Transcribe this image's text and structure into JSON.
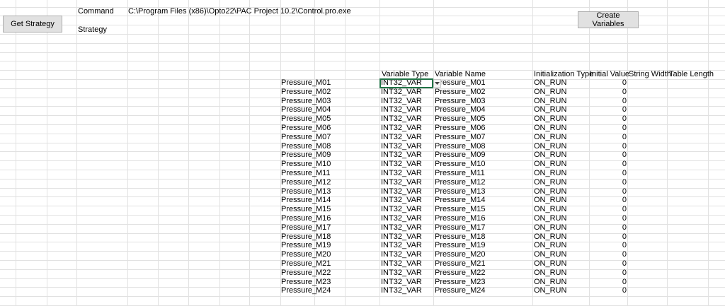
{
  "buttons": {
    "get_strategy": "Get Strategy",
    "create_variables": "Create Variables"
  },
  "labels": {
    "command": "Command",
    "command_path": "C:\\Program Files (x86)\\Opto22\\PAC Project 10.2\\Control.pro.exe",
    "strategy": "Strategy"
  },
  "table": {
    "headers": {
      "variable_type": "Variable Type",
      "variable_name": "Variable Name",
      "initialization_type": "Initialization Type",
      "initial_value": "Initial Value",
      "string_width": "String Width",
      "table_length": "Table Length"
    },
    "rows": [
      {
        "prefix": "Pressure_",
        "suffix": "M01",
        "type": "INT32_VAR",
        "name": "Pressure_M01",
        "init": "ON_RUN",
        "value": "0"
      },
      {
        "prefix": "Pressure_",
        "suffix": "M02",
        "type": "INT32_VAR",
        "name": "Pressure_M02",
        "init": "ON_RUN",
        "value": "0"
      },
      {
        "prefix": "Pressure_",
        "suffix": "M03",
        "type": "INT32_VAR",
        "name": "Pressure_M03",
        "init": "ON_RUN",
        "value": "0"
      },
      {
        "prefix": "Pressure_",
        "suffix": "M04",
        "type": "INT32_VAR",
        "name": "Pressure_M04",
        "init": "ON_RUN",
        "value": "0"
      },
      {
        "prefix": "Pressure_",
        "suffix": "M05",
        "type": "INT32_VAR",
        "name": "Pressure_M05",
        "init": "ON_RUN",
        "value": "0"
      },
      {
        "prefix": "Pressure_",
        "suffix": "M06",
        "type": "INT32_VAR",
        "name": "Pressure_M06",
        "init": "ON_RUN",
        "value": "0"
      },
      {
        "prefix": "Pressure_",
        "suffix": "M07",
        "type": "INT32_VAR",
        "name": "Pressure_M07",
        "init": "ON_RUN",
        "value": "0"
      },
      {
        "prefix": "Pressure_",
        "suffix": "M08",
        "type": "INT32_VAR",
        "name": "Pressure_M08",
        "init": "ON_RUN",
        "value": "0"
      },
      {
        "prefix": "Pressure_",
        "suffix": "M09",
        "type": "INT32_VAR",
        "name": "Pressure_M09",
        "init": "ON_RUN",
        "value": "0"
      },
      {
        "prefix": "Pressure_",
        "suffix": "M10",
        "type": "INT32_VAR",
        "name": "Pressure_M10",
        "init": "ON_RUN",
        "value": "0"
      },
      {
        "prefix": "Pressure_",
        "suffix": "M11",
        "type": "INT32_VAR",
        "name": "Pressure_M11",
        "init": "ON_RUN",
        "value": "0"
      },
      {
        "prefix": "Pressure_",
        "suffix": "M12",
        "type": "INT32_VAR",
        "name": "Pressure_M12",
        "init": "ON_RUN",
        "value": "0"
      },
      {
        "prefix": "Pressure_",
        "suffix": "M13",
        "type": "INT32_VAR",
        "name": "Pressure_M13",
        "init": "ON_RUN",
        "value": "0"
      },
      {
        "prefix": "Pressure_",
        "suffix": "M14",
        "type": "INT32_VAR",
        "name": "Pressure_M14",
        "init": "ON_RUN",
        "value": "0"
      },
      {
        "prefix": "Pressure_",
        "suffix": "M15",
        "type": "INT32_VAR",
        "name": "Pressure_M15",
        "init": "ON_RUN",
        "value": "0"
      },
      {
        "prefix": "Pressure_",
        "suffix": "M16",
        "type": "INT32_VAR",
        "name": "Pressure_M16",
        "init": "ON_RUN",
        "value": "0"
      },
      {
        "prefix": "Pressure_",
        "suffix": "M17",
        "type": "INT32_VAR",
        "name": "Pressure_M17",
        "init": "ON_RUN",
        "value": "0"
      },
      {
        "prefix": "Pressure_",
        "suffix": "M18",
        "type": "INT32_VAR",
        "name": "Pressure_M18",
        "init": "ON_RUN",
        "value": "0"
      },
      {
        "prefix": "Pressure_",
        "suffix": "M19",
        "type": "INT32_VAR",
        "name": "Pressure_M19",
        "init": "ON_RUN",
        "value": "0"
      },
      {
        "prefix": "Pressure_",
        "suffix": "M20",
        "type": "INT32_VAR",
        "name": "Pressure_M20",
        "init": "ON_RUN",
        "value": "0"
      },
      {
        "prefix": "Pressure_",
        "suffix": "M21",
        "type": "INT32_VAR",
        "name": "Pressure_M21",
        "init": "ON_RUN",
        "value": "0"
      },
      {
        "prefix": "Pressure_",
        "suffix": "M22",
        "type": "INT32_VAR",
        "name": "Pressure_M22",
        "init": "ON_RUN",
        "value": "0"
      },
      {
        "prefix": "Pressure_",
        "suffix": "M23",
        "type": "INT32_VAR",
        "name": "Pressure_M23",
        "init": "ON_RUN",
        "value": "0"
      },
      {
        "prefix": "Pressure_",
        "suffix": "M24",
        "type": "INT32_VAR",
        "name": "Pressure_M24",
        "init": "ON_RUN",
        "value": "0"
      }
    ]
  },
  "colors": {
    "gridline": "#e1e1e1",
    "selection": "#217346",
    "button_face": "#e1e1e1",
    "button_border": "#adadad"
  }
}
